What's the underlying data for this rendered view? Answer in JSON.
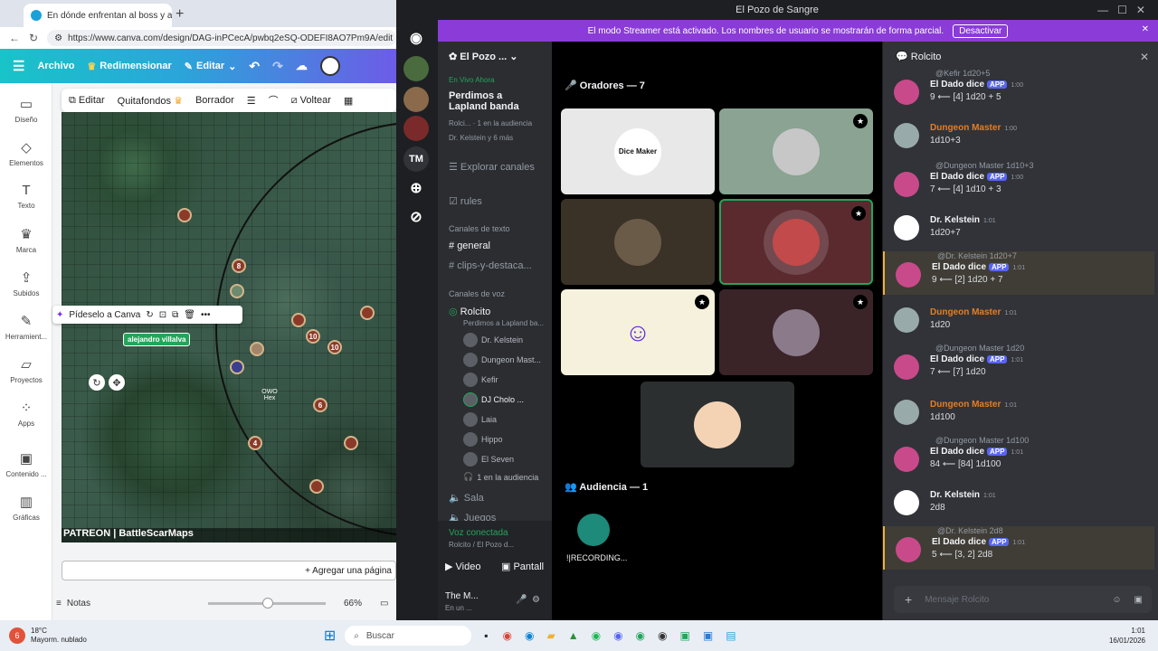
{
  "browser": {
    "tab_title": "En dónde enfrentan al boss y al c",
    "url": "https://www.canva.com/design/DAG-inPCecA/pwbq2eSQ-ODEFI8AO7Pm9A/edit"
  },
  "canva": {
    "menu_archivo": "Archivo",
    "menu_redimensionar": "Redimensionar",
    "menu_editar": "Editar",
    "nav": [
      {
        "label": "Diseño",
        "icon": "layout-icon"
      },
      {
        "label": "Elementos",
        "icon": "shapes-icon"
      },
      {
        "label": "Texto",
        "icon": "text-icon"
      },
      {
        "label": "Marca",
        "icon": "crown-icon"
      },
      {
        "label": "Subidos",
        "icon": "upload-icon"
      },
      {
        "label": "Herramient...",
        "icon": "tools-icon"
      },
      {
        "label": "Proyectos",
        "icon": "folder-icon"
      },
      {
        "label": "Apps",
        "icon": "apps-icon"
      },
      {
        "label": "Contenido ...",
        "icon": "content-icon"
      },
      {
        "label": "Gráficas",
        "icon": "chart-icon"
      }
    ],
    "toolbar": {
      "editar": "Editar",
      "quitafondos": "Quitafondos",
      "borrador": "Borrador",
      "voltear": "Voltear"
    },
    "popup_label": "Pídeselo a Canva",
    "user_tag": "alejandro villalva",
    "map_tokens": [
      "8",
      "10",
      "10",
      "4",
      "6"
    ],
    "map_label": "OWO Hex",
    "watermark": "PATREON | BattleScarMaps",
    "add_page": "+ Agregar una página",
    "notes": "Notas",
    "zoom": "66%"
  },
  "discord": {
    "window_title": "El Pozo de Sangre",
    "streamer_banner": "El modo Streamer está activado. Los nombres de usuario se mostrarán de forma parcial.",
    "streamer_button": "Desactivar",
    "server_name": "El Pozo ...",
    "live": {
      "status": "En Vivo Ahora",
      "title": "Perdimos a Lapland banda",
      "sub": "Rolci... · 1 en la audiencia",
      "members": "Dr. Kelstein y 6 más"
    },
    "server_icon_label": "TM",
    "explore": "Explorar canales",
    "rules": "rules",
    "text_category": "Canales de texto",
    "text_channels": [
      "general",
      "clips-y-destaca..."
    ],
    "voice_category": "Canales de voz",
    "voice_channel": "Rolcito",
    "voice_status": "Perdimos a Lapland ba...",
    "voice_members": [
      "Dr. Kelstein",
      "Dungeon Mast...",
      "Kefir",
      "DJ Cholo ...",
      "Laia",
      "Hippo",
      "El Seven"
    ],
    "audience_count": "1 en la audiencia",
    "other_voice": [
      "Sala",
      "Juegos"
    ],
    "connected": {
      "title": "Voz conectada",
      "sub": "Rolcito / El Pozo d...",
      "video": "Video",
      "screen": "Pantall"
    },
    "user": {
      "name": "The M...",
      "status": "En un ..."
    },
    "stage_speakers_header": "Oradores — 7",
    "stage_audience_header": "Audiencia — 1",
    "audience_member": "!|RECORDING...",
    "logo_text": "Dice Maker",
    "chat_channel": "Rolcito",
    "chat_placeholder": "Mensaje Rolcito",
    "messages": [
      {
        "reply": "@Kefir 1d20+5",
        "name": "El Dado dice",
        "app": "APP",
        "time": "1:00",
        "text": "9 ⟵ [4] 1d20 + 5",
        "type": "bot"
      },
      {
        "reply": "",
        "name": "Dungeon Master",
        "app": "",
        "time": "1:00",
        "text": "1d10+3",
        "type": "dm"
      },
      {
        "reply": "@Dungeon Master 1d10+3",
        "name": "El Dado dice",
        "app": "APP",
        "time": "1:00",
        "text": "7 ⟵ [4] 1d10 + 3",
        "type": "bot"
      },
      {
        "reply": "",
        "name": "Dr. Kelstein",
        "app": "",
        "time": "1:01",
        "text": "1d20+7",
        "type": "kel"
      },
      {
        "reply": "@Dr. Kelstein 1d20+7",
        "name": "El Dado dice",
        "app": "APP",
        "time": "1:01",
        "text": "9 ⟵ [2] 1d20 + 7",
        "type": "bot-mention"
      },
      {
        "reply": "",
        "name": "Dungeon Master",
        "app": "",
        "time": "1:01",
        "text": "1d20",
        "type": "dm"
      },
      {
        "reply": "@Dungeon Master 1d20",
        "name": "El Dado dice",
        "app": "APP",
        "time": "1:01",
        "text": "7 ⟵ [7] 1d20",
        "type": "bot"
      },
      {
        "reply": "",
        "name": "Dungeon Master",
        "app": "",
        "time": "1:01",
        "text": "1d100",
        "type": "dm"
      },
      {
        "reply": "@Dungeon Master 1d100",
        "name": "El Dado dice",
        "app": "APP",
        "time": "1:01",
        "text": "84 ⟵ [84] 1d100",
        "type": "bot"
      },
      {
        "reply": "",
        "name": "Dr. Kelstein",
        "app": "",
        "time": "1:01",
        "text": "2d8",
        "type": "kel"
      },
      {
        "reply": "@Dr. Kelstein 2d8",
        "name": "El Dado dice",
        "app": "APP",
        "time": "1:01",
        "text": "5 ⟵ [3, 2] 2d8",
        "type": "bot-mention"
      }
    ]
  },
  "taskbar": {
    "weather_temp": "18°C",
    "weather_desc": "Mayorm. nublado",
    "weather_badge": "6",
    "search": "Buscar",
    "time": "1:01",
    "date": "16/01/2026"
  }
}
